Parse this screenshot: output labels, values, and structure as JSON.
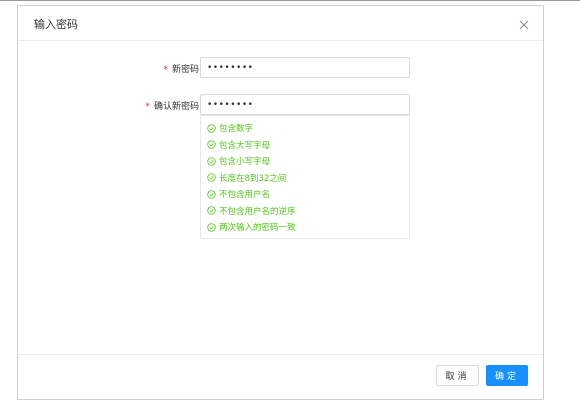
{
  "dialog": {
    "title": "输入密码",
    "close_icon": "close-icon"
  },
  "form": {
    "new_password": {
      "label": "新密码：",
      "required_mark": "*",
      "value": "••••••••"
    },
    "confirm_password": {
      "label": "确认新密码：",
      "required_mark": "*",
      "value": "••••••••"
    }
  },
  "rules": [
    "包含数字",
    "包含大写字母",
    "包含小写字母",
    "长度在8到32之间",
    "不包含用户名",
    "不包含用户名的逆序",
    "两次输入的密码一致"
  ],
  "rule_status_color": "#52c41a",
  "rule_icon": "check-circle-icon",
  "footer": {
    "cancel_label": "取消",
    "ok_label": "确定"
  },
  "colors": {
    "primary": "#1890ff",
    "required": "#f5222d"
  }
}
